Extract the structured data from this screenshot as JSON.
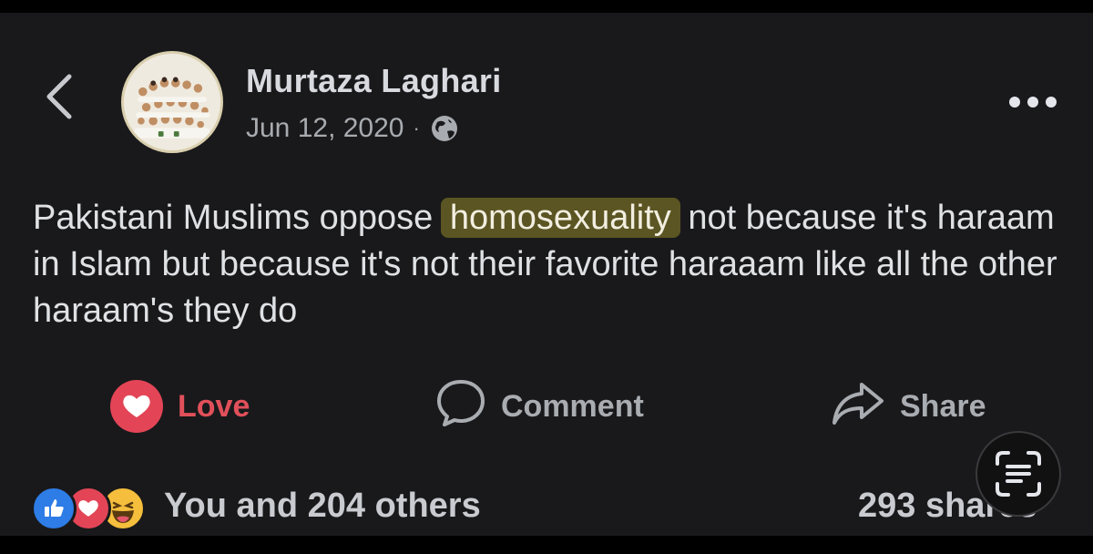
{
  "post": {
    "author": "Murtaza Laghari",
    "date": "Jun 12, 2020",
    "separator": "·",
    "text_before": "Pakistani Muslims oppose",
    "text_highlight": "homosexuality",
    "text_after": "not because it's haraam in Islam but because it's not their favorite haraaam like all the other haraam's they do"
  },
  "actions": {
    "love_label": "Love",
    "comment_label": "Comment",
    "share_label": "Share"
  },
  "footer": {
    "reactions_text": "You and 204 others",
    "shares_text": "293 shares"
  },
  "icons": {
    "back": "chevron-left-icon",
    "audience": "globe-icon",
    "more": "more-horizontal-icon",
    "love": "heart-icon",
    "comment": "speech-bubble-icon",
    "share": "share-arrow-icon",
    "live_text": "live-text-icon"
  },
  "colors": {
    "background": "#19191b",
    "love_accent": "#e34557",
    "highlight": "#5b5523",
    "like_blue": "#2e7ce6",
    "haha_yellow": "#f5be3c"
  }
}
